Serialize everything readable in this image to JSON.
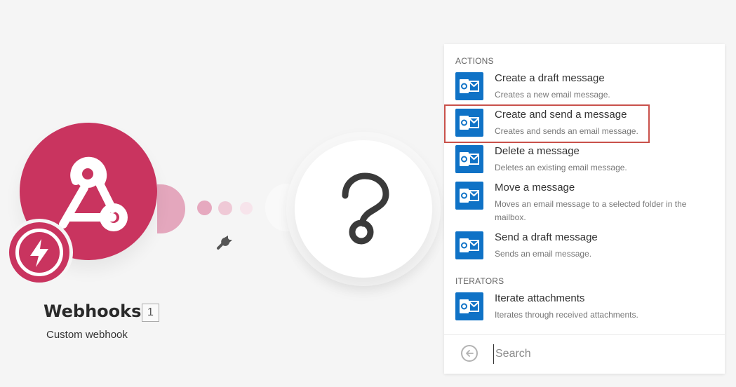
{
  "canvas": {
    "source_module": {
      "title": "Webhooks",
      "badge": "1",
      "subtitle": "Custom webhook",
      "icon": "webhook-icon",
      "instant_icon": "lightning-bolt-icon",
      "color": "#c9345f"
    },
    "connector_settings_icon": "wrench-icon",
    "placeholder_module_icon": "question-mark-icon"
  },
  "picker": {
    "sections": [
      {
        "title": "ACTIONS",
        "items": [
          {
            "name": "Create a draft message",
            "desc": "Creates a new email message."
          },
          {
            "name": "Create and send a message",
            "desc": "Creates and sends an email message.",
            "highlighted": true
          },
          {
            "name": "Delete a message",
            "desc": "Deletes an existing email message."
          },
          {
            "name": "Move a message",
            "desc": "Moves an email message to a selected folder in the mailbox."
          },
          {
            "name": "Send a draft message",
            "desc": "Sends an email message."
          }
        ]
      },
      {
        "title": "ITERATORS",
        "items": [
          {
            "name": "Iterate attachments",
            "desc": "Iterates through received attachments."
          }
        ]
      }
    ],
    "item_icon": "outlook-icon",
    "item_icon_color": "#0f72c6",
    "highlight_color": "#c9514b",
    "search": {
      "placeholder": "Search",
      "value": ""
    },
    "back_icon": "back-arrow-icon"
  }
}
